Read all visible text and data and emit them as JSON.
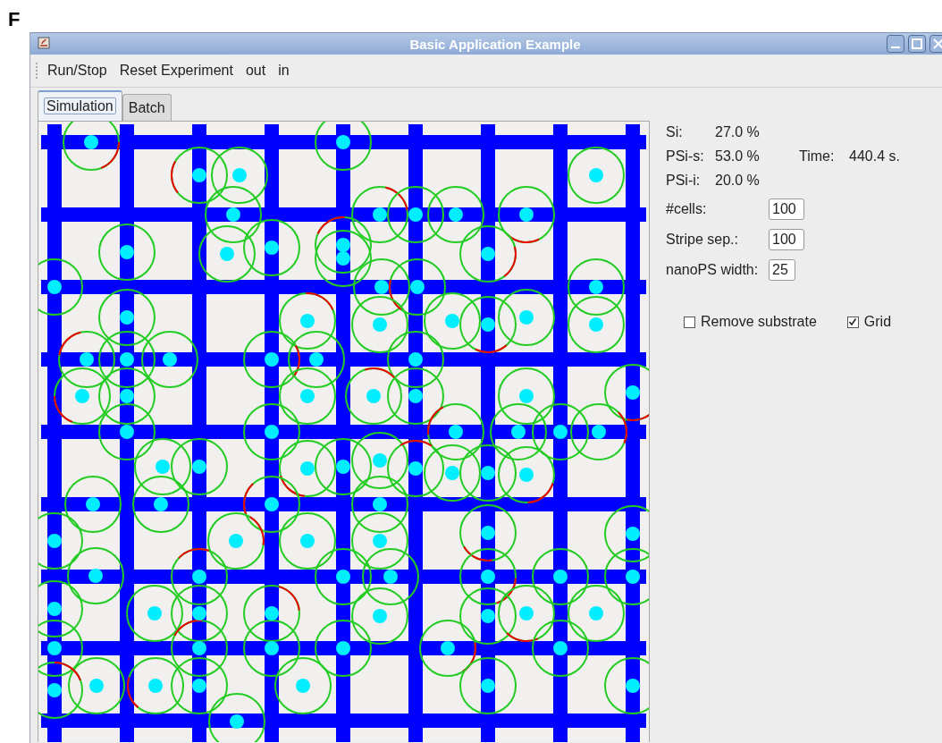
{
  "panel_label": "F",
  "window": {
    "title": "Basic Application Example"
  },
  "menu": [
    {
      "label": "Run/Stop"
    },
    {
      "label": "Reset Experiment"
    },
    {
      "label": "out"
    },
    {
      "label": "in"
    }
  ],
  "tabs": [
    {
      "label": "Simulation",
      "selected": true
    },
    {
      "label": "Batch",
      "selected": false
    }
  ],
  "readings": [
    {
      "label": "Si:",
      "value": "27.0 %"
    },
    {
      "label": "PSi-s:",
      "value": "53.0 %"
    },
    {
      "label": "PSi-i:",
      "value": "20.0 %"
    }
  ],
  "time": {
    "label": "Time:",
    "value": "440.4 s."
  },
  "fields": [
    {
      "label": "#cells:",
      "value": "100"
    },
    {
      "label": "Stripe sep.:",
      "value": "100"
    },
    {
      "label": "nanoPS width:",
      "value": "25"
    }
  ],
  "checkboxes": [
    {
      "label": "Remove substrate",
      "checked": false
    },
    {
      "label": "Grid",
      "checked": true
    }
  ]
}
